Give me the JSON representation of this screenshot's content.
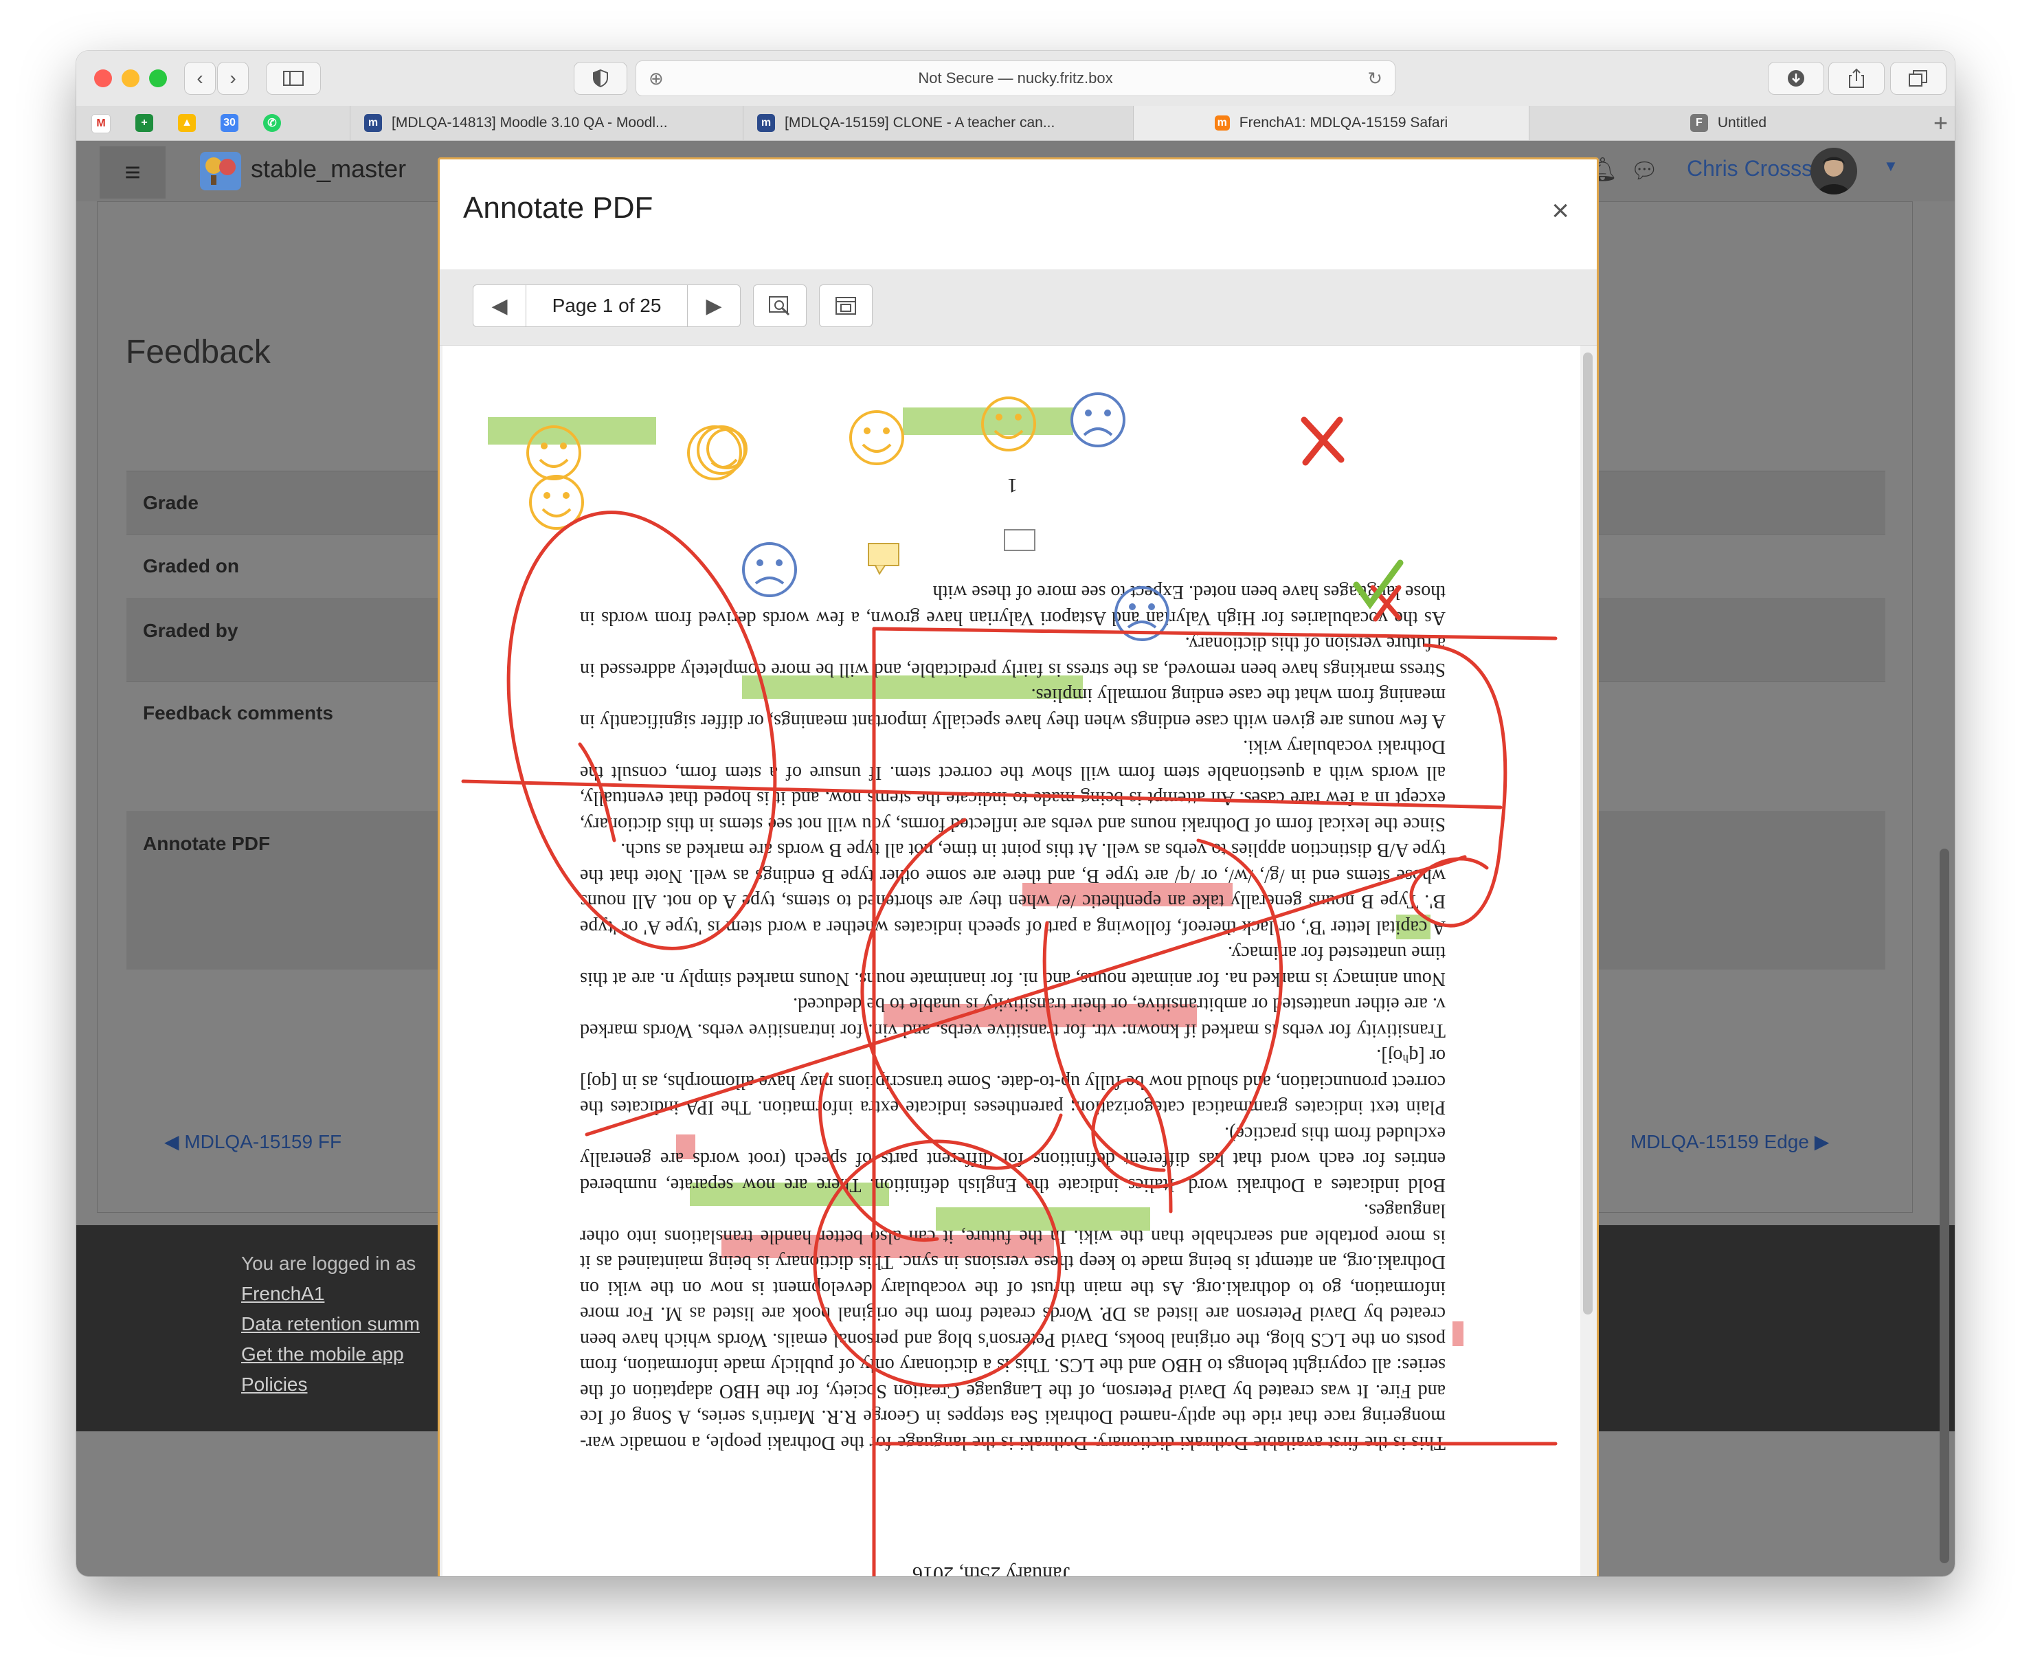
{
  "browser": {
    "address": "Not Secure — nucky.fritz.box",
    "tabs": [
      {
        "label": "[MDLQA-14813] Moodle 3.10 QA - Moodl..."
      },
      {
        "label": "[MDLQA-15159] CLONE - A teacher can..."
      },
      {
        "label": "FrenchA1: MDLQA-15159 Safari"
      },
      {
        "label": "Untitled"
      }
    ]
  },
  "site": {
    "name": "stable_master",
    "user": "Chris Crosss"
  },
  "feedback": {
    "heading": "Feedback",
    "rows": [
      "Grade",
      "Graded on",
      "Graded by",
      "Feedback comments",
      "Annotate PDF"
    ]
  },
  "nav": {
    "prev": "◀ MDLQA-15159 FF",
    "next": "MDLQA-15159 Edge ▶"
  },
  "footer": {
    "logged_in": "You are logged in as",
    "user_link": "FrenchA1",
    "retention": "Data retention summ",
    "mobile": "Get the mobile app",
    "policies": "Policies"
  },
  "modal": {
    "title": "Annotate PDF",
    "close": "×",
    "page_indicator": "Page 1 of 25"
  },
  "pdf": {
    "page_number": "1",
    "date": "January 25th, 2016",
    "paragraphs": [
      "This is the first available Dothraki dictionary. Dothraki is the language for the Dothraki people, a nomadic war-mongering race that ride the aptly-named Dothraki Sea steppes in George R.R. Martin's series, A Song of Ice and Fire. It was created by David Peterson, of the Language Creation Society, for the HBO adaptation of the series: all copyright belongs to HBO and the LCS. This is a dictionary only of publicly made information, from posts on the LCS blog, the original books, David Peterson's blog and personal emails. Words which have been created by David Peterson are listed as DP. Words created from the original book are listed as M. For more information, go to dothraki.org. As the main thrust of the vocabulary development is now on the wiki on Dothraki.org, an attempt is being made to keep these versions in sync. This dictionary is being maintained as it is more portable and searchable than the wiki. In the future, it can also better handle translations into other languages.",
      "Bold indicates a Dothraki word. Italics indicate the English definition. There are now separate, numbered entries for each word that has different definitions for different parts of speech (root words are generally excluded from this practice).",
      "Plain text indicates grammatical categorization; parentheses indicate extra information. The IPA indicates the correct pronunciation, and should now be fully up-to-date. Some transcriptions may have allomorphs, as in [qoj] or [qʰoj].",
      "Transitivity for verbs is marked if known: vtr. for transitive verbs, and vin. for intransitive verbs. Words marked v. are either unattested or ambitransitive, or their transitivity is unable to be deduced.",
      "Noun animacy is marked na. for animate nouns, and ni. for inanimate nouns. Nouns marked simply n. are at this time unattested for animacy.",
      "A capital letter 'B', or lack thereof, following a part of speech indicates whether a word stem is 'type A' or 'type B'. Type B nouns generally take an epenthetic /e/ when they are shortened to stems, type A do not. All nouns whose stems end in /g/, /w/, or /q/ are type B, and there are some other type B endings as well. Note that the type A/B distinction applies to verbs as well. At this point in time, not all type B words are marked as such.",
      "Since the lexical form of Dothraki nouns and verbs are inflected forms, you will not see stems in this dictionary, except in a few rare cases. An attempt is being made to indicate the stems now, and it is hoped that eventually, all words with a questionable stem form will show the correct stem. If unsure of a stem form, consult the Dothraki vocabulary wiki.",
      "A few nouns are given with case endings when they have specially important meanings, or differ significantly in meaning from what the case ending normally implies.",
      "Stress markings have been removed, as the stress is fairly predictable, and will be more completely addressed in a future version of this dictionary.",
      "As the vocabularies for High Valyrian and Astapori Valyrian have grown, a few words derived from words in those languages have been noted. Expect to see more of these with"
    ]
  },
  "colors": {
    "accent": "#e0a74c",
    "annotation_red": "#e03b2e",
    "highlight_green": "#b7dc8a",
    "highlight_red": "#f0a0a0",
    "smiley": "#f5b731",
    "frown": "#5b7fc4",
    "tick": "#7bbd3d"
  }
}
